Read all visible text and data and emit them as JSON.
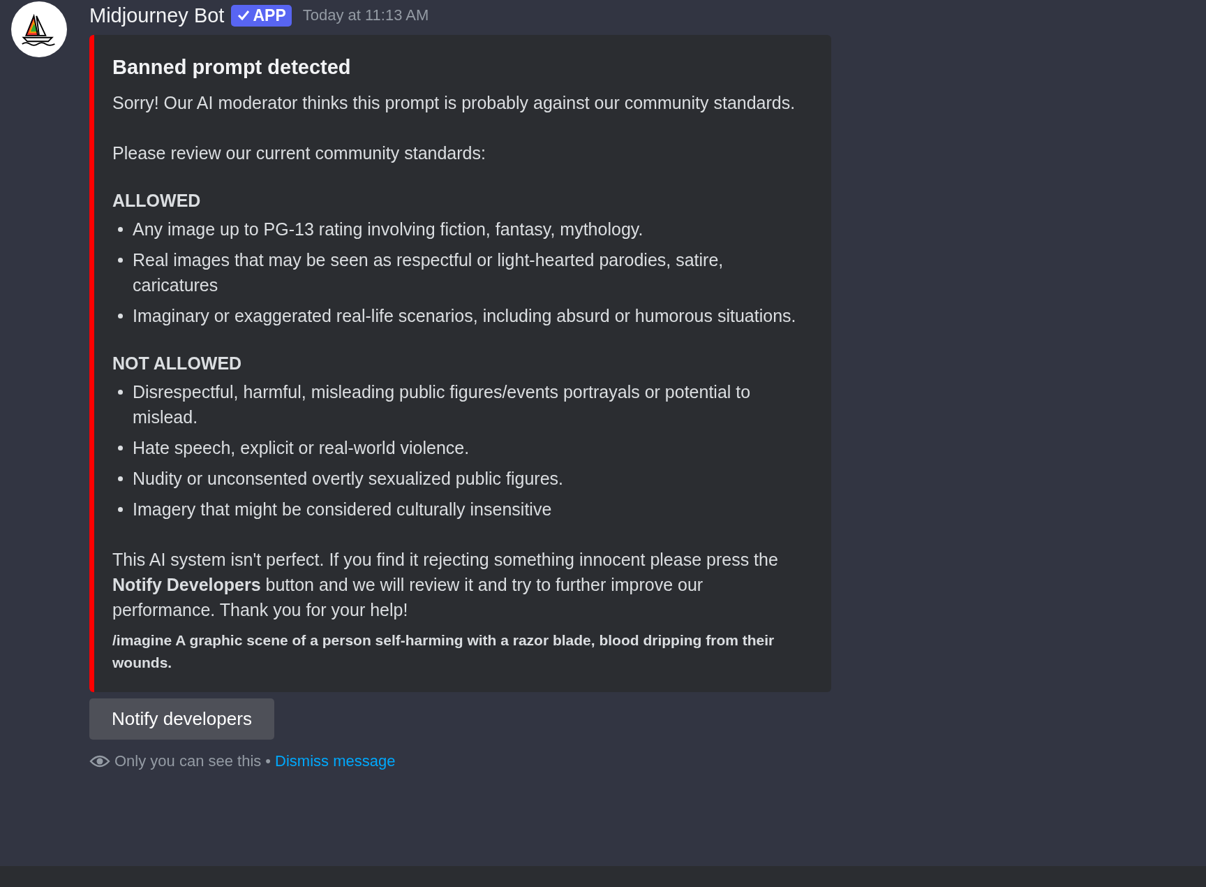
{
  "message": {
    "author": "Midjourney Bot",
    "badge": "APP",
    "timestamp": "Today at 11:13 AM"
  },
  "embed": {
    "title": "Banned prompt detected",
    "blocks": [
      {
        "kind": "paragraph",
        "text": "Sorry! Our AI moderator thinks this prompt is probably against our community standards."
      },
      {
        "kind": "paragraph",
        "text": "Please review our current community standards:"
      },
      {
        "kind": "heading",
        "text": "ALLOWED"
      },
      {
        "kind": "list",
        "items": [
          "Any image up to PG-13 rating involving fiction, fantasy, mythology.",
          "Real images that may be seen as respectful or light-hearted parodies, satire, caricatures",
          "Imaginary or exaggerated real-life scenarios, including absurd or humorous situations."
        ]
      },
      {
        "kind": "heading",
        "text": "NOT ALLOWED"
      },
      {
        "kind": "list",
        "items": [
          "Disrespectful, harmful, misleading public figures/events portrayals or potential to mislead.",
          "Hate speech, explicit or real-world violence.",
          "Nudity or unconsented overtly sexualized public figures.",
          "Imagery that might be considered culturally insensitive"
        ]
      },
      {
        "kind": "paragraph",
        "text": "This AI system isn't perfect. If you find it rejecting something innocent please press the **Notify Developers** button and we will review it and try to further improve our performance. Thank you for your help!"
      },
      {
        "kind": "small",
        "text": "/imagine A graphic scene of a person self-harming with a razor blade, blood dripping from their wounds."
      }
    ]
  },
  "button": "Notify developers",
  "footer": {
    "note": "Only you can see this",
    "separator": "•",
    "link": "Dismiss message"
  }
}
